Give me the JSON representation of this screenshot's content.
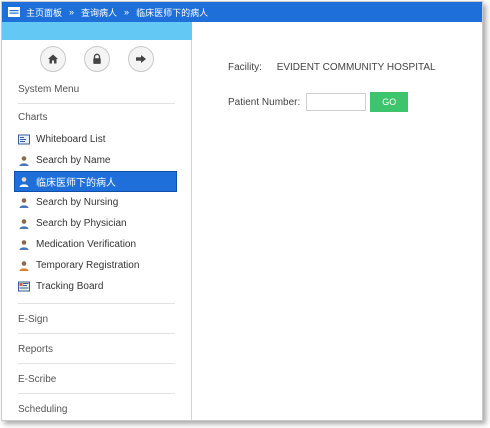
{
  "colors": {
    "topbar": "#1e6fd9",
    "accent": "#64c8f4",
    "go_button": "#3ec46d",
    "active_item": "#1e6fd9"
  },
  "breadcrumb": {
    "items": [
      "主页面板",
      "查询病人",
      "临床医师下的病人"
    ],
    "separator": "»"
  },
  "sidebar": {
    "icon_buttons": [
      "home-icon",
      "lock-icon",
      "sign-out-icon"
    ],
    "title": "System Menu",
    "sections": {
      "charts": {
        "label": "Charts",
        "items": [
          {
            "label": "Whiteboard List",
            "icon": "whiteboard-icon"
          },
          {
            "label": "Search by Name",
            "icon": "user-icon"
          },
          {
            "label": "临床医师下的病人",
            "icon": "user-icon",
            "active": true
          },
          {
            "label": "Search by Nursing",
            "icon": "user-icon"
          },
          {
            "label": "Search by Physician",
            "icon": "user-icon"
          },
          {
            "label": "Medication Verification",
            "icon": "user-icon"
          },
          {
            "label": "Temporary Registration",
            "icon": "user-icon"
          },
          {
            "label": "Tracking Board",
            "icon": "board-icon"
          }
        ]
      },
      "esign": {
        "label": "E-Sign"
      },
      "reports": {
        "label": "Reports"
      },
      "escribe": {
        "label": "E-Scribe"
      },
      "scheduling": {
        "label": "Scheduling"
      }
    }
  },
  "main": {
    "facility_label": "Facility:",
    "facility_value": "EVIDENT COMMUNITY HOSPITAL",
    "patient_label": "Patient Number:",
    "patient_value": "",
    "go_label": "GO"
  }
}
